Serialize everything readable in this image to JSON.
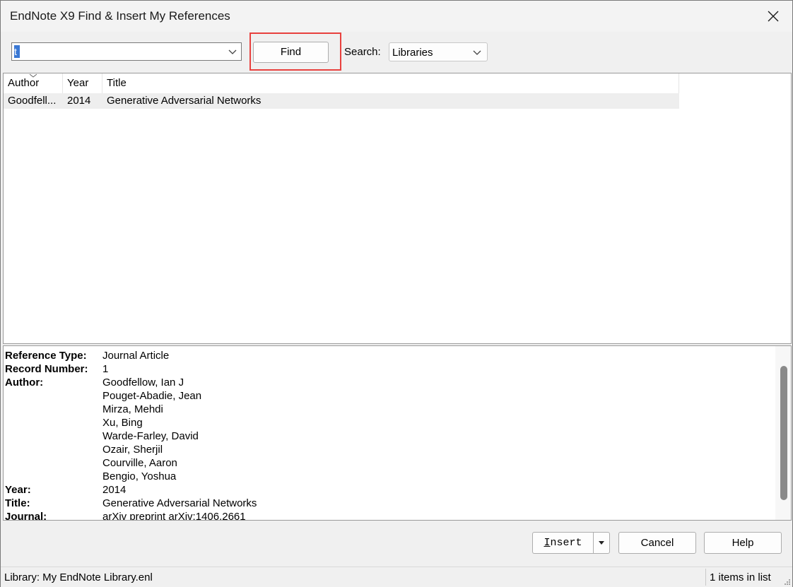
{
  "window": {
    "title": "EndNote X9 Find & Insert My References"
  },
  "toolbar": {
    "search_value": "t",
    "find_label": "Find",
    "search_label": "Search:",
    "search_scope": "Libraries"
  },
  "list": {
    "columns": [
      "Author",
      "Year",
      "Title"
    ],
    "rows": [
      {
        "author": "Goodfell...",
        "year": "2014",
        "title": "Generative Adversarial Networks"
      }
    ]
  },
  "detail": {
    "reference_type_label": "Reference Type:",
    "reference_type": "Journal Article",
    "record_number_label": "Record Number:",
    "record_number": "1",
    "author_label": "Author:",
    "authors": [
      "Goodfellow, Ian J",
      "Pouget-Abadie, Jean",
      "Mirza, Mehdi",
      "Xu, Bing",
      "Warde-Farley, David",
      "Ozair, Sherjil",
      "Courville, Aaron",
      "Bengio, Yoshua"
    ],
    "year_label": "Year:",
    "year": "2014",
    "title_label": "Title:",
    "title": "Generative Adversarial Networks",
    "journal_label": "Journal:",
    "journal": "arXiv preprint arXiv:1406.2661"
  },
  "buttons": {
    "insert_rest": "nsert",
    "insert_accel": "I",
    "cancel": "Cancel",
    "help": "Help"
  },
  "status": {
    "library": "Library: My EndNote Library.enl",
    "count": "1 items in list"
  },
  "colors": {
    "highlight": "#e8413e",
    "selection": "#3a78d4"
  }
}
